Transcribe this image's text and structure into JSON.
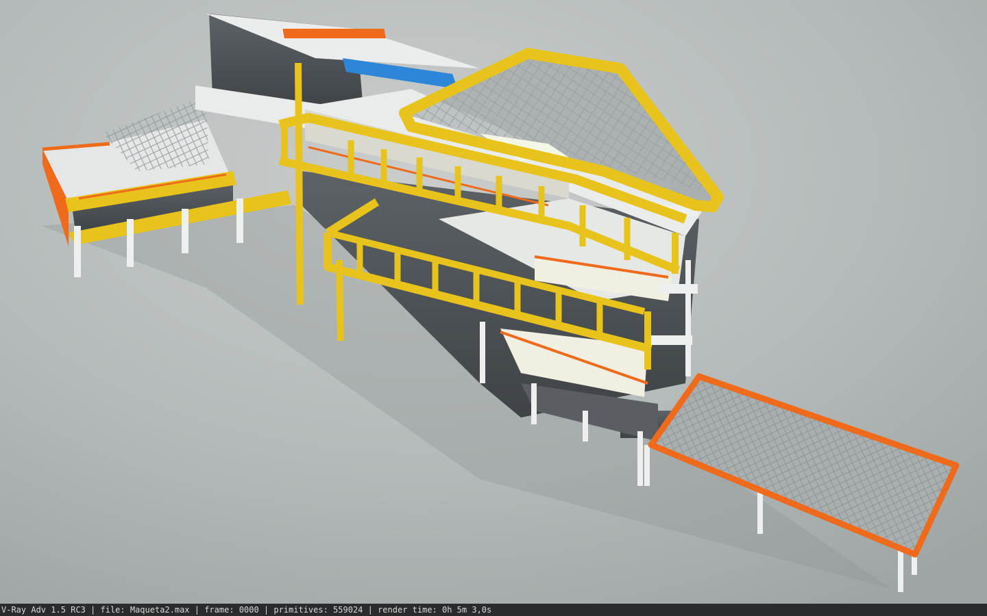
{
  "render": {
    "statusbar_text": "V-Ray Adv 1.5 RC3 | file: Maqueta2.max | frame: 0000 | primitives: 559024 | render time: 0h 5m 3,0s"
  },
  "colors": {
    "background": "#a4aaa9",
    "floor_light": "#c9cdcc",
    "slab_white": "#e9ecea",
    "frame_yellow": "#e8c31c",
    "accent_orange": "#ef6a1a",
    "accent_blue": "#2e86d8",
    "glass_dark": "#4f5356",
    "mesh": "#9aa0a3"
  }
}
